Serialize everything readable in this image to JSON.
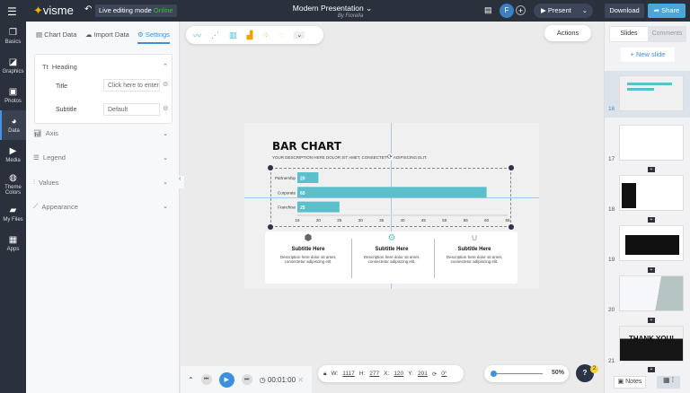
{
  "topbar": {
    "logo": "visme",
    "live_mode": "Live editing mode",
    "status": "Online",
    "title": "Modern Presentation",
    "byline": "By Fiorella",
    "avatar": "F",
    "present": "Present",
    "download": "Download",
    "share": "Share"
  },
  "rail": [
    {
      "label": "Basics",
      "icon": "cube-icon"
    },
    {
      "label": "Graphics",
      "icon": "shapes-icon"
    },
    {
      "label": "Photos",
      "icon": "photo-icon"
    },
    {
      "label": "Data",
      "icon": "pie-icon"
    },
    {
      "label": "Media",
      "icon": "video-icon"
    },
    {
      "label": "Theme Colors",
      "icon": "palette-icon"
    },
    {
      "label": "My Files",
      "icon": "folder-icon"
    },
    {
      "label": "Apps",
      "icon": "grid-icon"
    }
  ],
  "panel": {
    "tabs": [
      "Chart Data",
      "Import Data",
      "Settings"
    ],
    "heading": "Heading",
    "title_label": "Title",
    "title_placeholder": "Click here to enter t",
    "subtitle_label": "Subtitle",
    "subtitle_value": "Default",
    "sections": [
      "Axis",
      "Legend",
      "Values",
      "Appearance"
    ]
  },
  "toolbar": {
    "actions": "Actions"
  },
  "slide": {
    "title": "BAR CHART",
    "description": "YOUR DESCRIPTION HERE DOLOR SIT AMET, CONSECTETUR ADIPISCING ELIT.",
    "cards": [
      {
        "title": "Subtitle Here",
        "text": "Description here dolor sit amet, consectetur adipiscing elit."
      },
      {
        "title": "Subtitle Here",
        "text": "Description here dolor sit amet, consectetur adipiscing elit."
      },
      {
        "title": "Subtitle Here",
        "text": "Description here dolor sit amet, consectetur adipiscing elit."
      }
    ]
  },
  "chart_data": {
    "type": "bar",
    "orientation": "horizontal",
    "categories": [
      "Partnership",
      "Corporate",
      "Franchise"
    ],
    "values": [
      20,
      60,
      25
    ],
    "xlim": [
      15,
      65
    ],
    "ticks": [
      15,
      20,
      25,
      30,
      35,
      40,
      45,
      50,
      55,
      60,
      65
    ],
    "color": "#5bc0cb"
  },
  "bottom": {
    "time": "00:01:00",
    "w_label": "W:",
    "w": "1117",
    "h_label": "H:",
    "h": "277",
    "x_label": "X:",
    "x": "120",
    "y_label": "Y:",
    "y": "201",
    "rotation": "0°",
    "zoom": "50%",
    "help_badge": "2"
  },
  "right": {
    "tabs": [
      "Slides",
      "Comments"
    ],
    "new_slide": "+ New slide",
    "slides": [
      "16",
      "17",
      "18",
      "19",
      "20",
      "21"
    ],
    "notes": "Notes"
  }
}
